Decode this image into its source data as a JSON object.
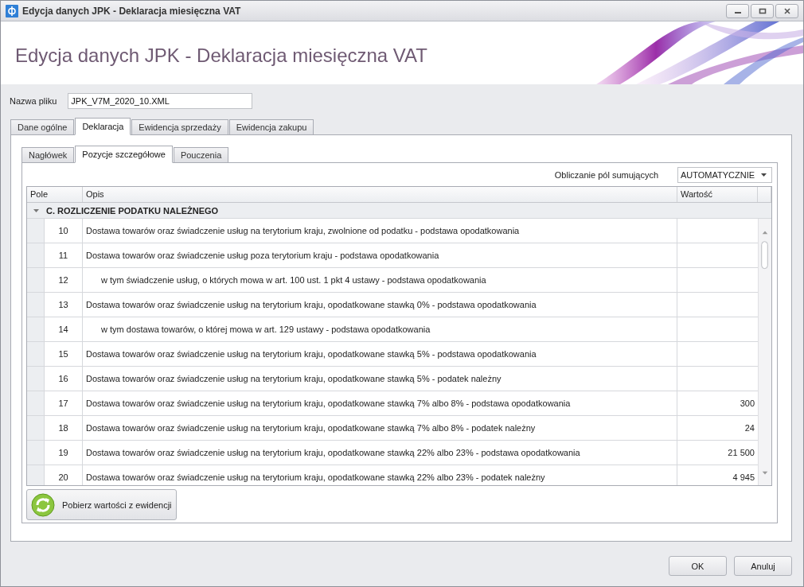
{
  "window": {
    "title": "Edycja danych JPK - Deklaracja miesięczna VAT"
  },
  "header": {
    "title": "Edycja danych JPK - Deklaracja miesięczna VAT"
  },
  "file": {
    "label": "Nazwa pliku",
    "value": "JPK_V7M_2020_10.XML"
  },
  "tabs": [
    {
      "label": "Dane ogólne",
      "selected": false
    },
    {
      "label": "Deklaracja",
      "selected": true
    },
    {
      "label": "Ewidencja sprzedaży",
      "selected": false
    },
    {
      "label": "Ewidencja zakupu",
      "selected": false
    }
  ],
  "subtabs": [
    {
      "label": "Nagłówek",
      "selected": false
    },
    {
      "label": "Pozycje szczegółowe",
      "selected": true
    },
    {
      "label": "Pouczenia",
      "selected": false
    }
  ],
  "summing": {
    "label": "Obliczanie pól sumujących",
    "value": "AUTOMATYCZNIE"
  },
  "table": {
    "columns": [
      "Pole",
      "Opis",
      "Wartość"
    ],
    "group": {
      "label": "C. ROZLICZENIE PODATKU NALEŻNEGO",
      "expanded": true
    },
    "rows": [
      {
        "kind": "main",
        "field": "10",
        "description": "Dostawa towarów oraz świadczenie usług na terytorium kraju, zwolnione od podatku - podstawa opodatkowania"
      },
      {
        "kind": "main",
        "field": "11",
        "description": "Dostawa towarów oraz świadczenie usług poza terytorium kraju - podstawa opodatkowania"
      },
      {
        "kind": "sub",
        "field": "12",
        "description": "w tym świadczenie usług, o których mowa w art. 100 ust. 1 pkt 4 ustawy - podstawa opodatkowania"
      },
      {
        "kind": "main",
        "field": "13",
        "description": "Dostawa towarów oraz świadczenie usług na terytorium kraju, opodatkowane stawką 0% - podstawa opodatkowania"
      },
      {
        "kind": "sub",
        "field": "14",
        "description": "w tym dostawa towarów, o której mowa w art. 129 ustawy - podstawa opodatkowania"
      },
      {
        "kind": "main",
        "field": "15",
        "description": "Dostawa towarów oraz świadczenie usług na terytorium kraju, opodatkowane stawką 5% - podstawa opodatkowania"
      },
      {
        "kind": "main",
        "field": "16",
        "description": "Dostawa towarów oraz świadczenie usług na terytorium kraju, opodatkowane stawką 5% - podatek należny"
      },
      {
        "kind": "main",
        "field": "17",
        "description": "Dostawa towarów oraz świadczenie usług na terytorium kraju, opodatkowane stawką 7% albo 8% - podstawa opodatkowania",
        "value": "300"
      },
      {
        "kind": "main",
        "field": "18",
        "description": "Dostawa towarów oraz świadczenie usług na terytorium kraju, opodatkowane stawką 7% albo 8% - podatek należny",
        "value": "24"
      },
      {
        "kind": "main",
        "field": "19",
        "description": "Dostawa towarów oraz świadczenie usług na terytorium kraju, opodatkowane stawką 22% albo 23% - podstawa opodatkowania",
        "value": "21 500"
      },
      {
        "kind": "main",
        "field": "20",
        "description": "Dostawa towarów oraz świadczenie usług na terytorium kraju, opodatkowane stawką 22% albo 23% - podatek należny",
        "value": "4 945"
      }
    ]
  },
  "fetch_button": {
    "label": "Pobierz wartości z ewidencji"
  },
  "buttons": [
    "OK",
    "Anuluj"
  ]
}
